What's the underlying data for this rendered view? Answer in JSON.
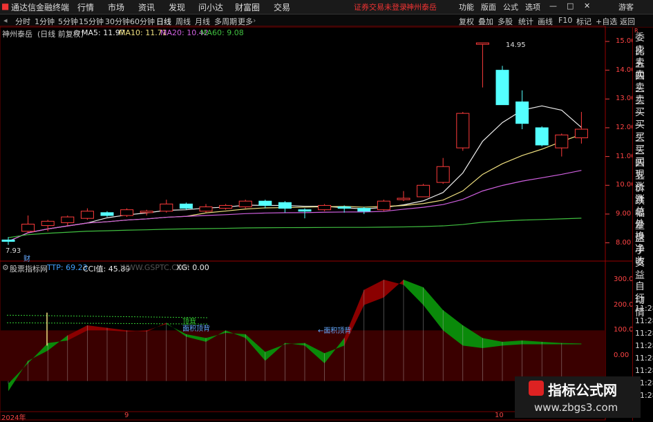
{
  "titlebar": {
    "app_name": "通达信金融终端",
    "menus": [
      "行情",
      "市场",
      "资讯",
      "发现",
      "问小达",
      "财富圈",
      "交易"
    ],
    "notice": "证券交易未登录",
    "stock": "神州泰岳",
    "right_items": [
      "功能",
      "版面",
      "公式",
      "选项"
    ],
    "guest": "游客"
  },
  "tabbar": {
    "periods": [
      "分时",
      "1分钟",
      "5分钟",
      "15分钟",
      "30分钟",
      "60分钟",
      "日线",
      "周线",
      "月线",
      "多周期",
      "更多"
    ],
    "tools": [
      "复权",
      "叠加",
      "多股",
      "统计",
      "画线",
      "F10",
      "标记",
      "+自选",
      "返回"
    ]
  },
  "main_chart": {
    "name": "神州泰岳",
    "mode": "(日线 前复权)",
    "ma5": "MA5: 11.97",
    "ma10": "MA10: 11.71",
    "ma20": "MA20: 10.42",
    "ma60": "MA60: 9.08",
    "price_ticks": [
      "15.00",
      "14.00",
      "13.00",
      "12.00",
      "11.00",
      "10.00",
      "9.00",
      "8.00"
    ],
    "high_label": "14.95",
    "low_label": "7.93",
    "cai_label": "财"
  },
  "indicator": {
    "name": "股票指标网",
    "ttp": "TTP: 69.23",
    "cci": "CCI值: 45.89",
    "site": "WWW.GSPTC.COM",
    "xg": "XG: 0.00",
    "ticks": [
      "300.0",
      "200.0",
      "100.0",
      "0.00"
    ],
    "ann1": "顶背",
    "ann2": "面积顶背",
    "ann3": "←面积顶背"
  },
  "xaxis": {
    "labels": [
      "2024年",
      "9",
      "10"
    ]
  },
  "rightcol": {
    "items": [
      "委比",
      "卖五",
      "卖四",
      "卖三",
      "卖二",
      "卖一",
      "买一",
      "买二",
      "买三",
      "买四",
      "买五",
      "现价",
      "涨跌",
      "涨幅",
      "总量",
      "外盘",
      "换手",
      "净资",
      "收益",
      "",
      "自动",
      "行情",
      "11:28",
      "11:28",
      "11:28",
      "11:28",
      "11:28",
      "11:28",
      "11:28",
      "11:28"
    ],
    "tag": "R"
  },
  "watermark": {
    "title": "指标公式网",
    "url": "www.zbgs3.com"
  },
  "chart_data": {
    "type": "candlestick",
    "title": "神州泰岳",
    "ylim": [
      7.5,
      15.2
    ],
    "candles": [
      {
        "o": 8.1,
        "c": 8.05,
        "h": 8.2,
        "l": 7.93
      },
      {
        "o": 8.4,
        "c": 8.65,
        "h": 8.95,
        "l": 8.35
      },
      {
        "o": 8.6,
        "c": 8.75,
        "h": 8.8,
        "l": 8.4
      },
      {
        "o": 8.7,
        "c": 8.9,
        "h": 8.95,
        "l": 8.6
      },
      {
        "o": 8.85,
        "c": 9.1,
        "h": 9.2,
        "l": 8.8
      },
      {
        "o": 9.05,
        "c": 8.95,
        "h": 9.1,
        "l": 8.9
      },
      {
        "o": 8.95,
        "c": 9.15,
        "h": 9.2,
        "l": 8.9
      },
      {
        "o": 9.05,
        "c": 9.1,
        "h": 9.15,
        "l": 8.95
      },
      {
        "o": 9.1,
        "c": 9.35,
        "h": 9.5,
        "l": 9.05
      },
      {
        "o": 9.35,
        "c": 9.2,
        "h": 9.4,
        "l": 9.15
      },
      {
        "o": 9.1,
        "c": 9.25,
        "h": 9.35,
        "l": 9.05
      },
      {
        "o": 9.2,
        "c": 9.3,
        "h": 9.35,
        "l": 9.15
      },
      {
        "o": 9.25,
        "c": 9.45,
        "h": 9.5,
        "l": 9.2
      },
      {
        "o": 9.45,
        "c": 9.3,
        "h": 9.5,
        "l": 9.2
      },
      {
        "o": 9.4,
        "c": 9.2,
        "h": 9.45,
        "l": 9.05
      },
      {
        "o": 9.15,
        "c": 9.1,
        "h": 9.2,
        "l": 8.85
      },
      {
        "o": 9.15,
        "c": 9.3,
        "h": 9.35,
        "l": 9.1
      },
      {
        "o": 9.25,
        "c": 9.2,
        "h": 9.3,
        "l": 9.05
      },
      {
        "o": 9.2,
        "c": 9.1,
        "h": 9.25,
        "l": 9.0
      },
      {
        "o": 9.15,
        "c": 9.45,
        "h": 9.5,
        "l": 9.1
      },
      {
        "o": 9.5,
        "c": 9.55,
        "h": 9.8,
        "l": 9.45
      },
      {
        "o": 9.6,
        "c": 10.0,
        "h": 10.05,
        "l": 9.6
      },
      {
        "o": 10.1,
        "c": 10.65,
        "h": 10.95,
        "l": 10.05
      },
      {
        "o": 11.3,
        "c": 12.5,
        "h": 12.55,
        "l": 11.2
      },
      {
        "o": 14.9,
        "c": 14.95,
        "h": 14.95,
        "l": 13.4
      },
      {
        "o": 14.0,
        "c": 12.8,
        "h": 14.15,
        "l": 12.8
      },
      {
        "o": 12.9,
        "c": 12.15,
        "h": 13.3,
        "l": 11.95
      },
      {
        "o": 12.0,
        "c": 11.4,
        "h": 12.05,
        "l": 11.35
      },
      {
        "o": 11.3,
        "c": 11.75,
        "h": 11.8,
        "l": 11.0
      },
      {
        "o": 11.65,
        "c": 11.95,
        "h": 12.55,
        "l": 11.45
      }
    ]
  }
}
